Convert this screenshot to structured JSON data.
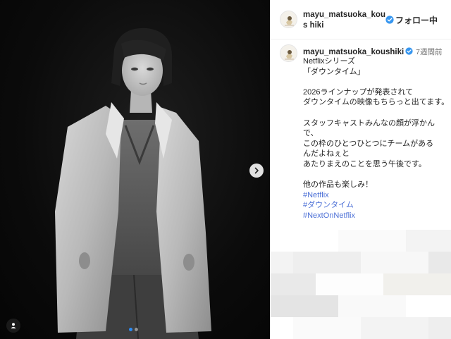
{
  "post": {
    "username": "mayu_matsuoka_koushiki",
    "header_username": "mayu_matsuoka_kous hiki",
    "follow_label": "フォロー中",
    "time": "7週間前",
    "caption_lines": [
      "Netflixシリーズ",
      "「ダウンタイム」",
      "",
      "2026ラインナップが発表されて",
      "ダウンタイムの映像もちらっと出てます。",
      "",
      "スタッフキャストみんなの顔が浮かん",
      "で、",
      "この枠のひとつひとつにチームがある",
      "んだよねぇと",
      "あたりまえのことを思う午後です。",
      "",
      "他の作品も楽しみ！"
    ],
    "hashtags": [
      "#Netflix",
      "#ダウンタイム",
      "#NextOnNetflix"
    ]
  },
  "media": {
    "carousel_count": 2,
    "carousel_active": 0,
    "icons": {
      "next": "chevron-right-icon",
      "tag": "user-tag-icon"
    }
  },
  "colors": {
    "verified": "#3897f0",
    "hashtag": "#4b6fd6",
    "dot_active": "#2b8cf6"
  }
}
